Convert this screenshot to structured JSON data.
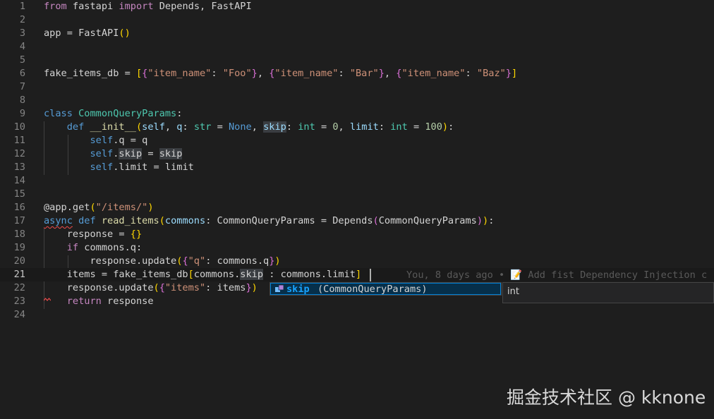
{
  "editor": {
    "lines": [
      {
        "n": "1",
        "segs": [
          [
            "from",
            "tok-ctrl"
          ],
          [
            " fastapi ",
            ""
          ],
          [
            "import",
            "tok-ctrl"
          ],
          [
            " Depends, FastAPI",
            ""
          ]
        ]
      },
      {
        "n": "2",
        "segs": []
      },
      {
        "n": "3",
        "segs": [
          [
            "app = FastAPI",
            ""
          ],
          [
            "()",
            "tok-br1"
          ]
        ]
      },
      {
        "n": "4",
        "segs": []
      },
      {
        "n": "5",
        "segs": []
      },
      {
        "n": "6",
        "segs": [
          [
            "fake_items_db = ",
            ""
          ],
          [
            "[",
            "tok-br1"
          ],
          [
            "{",
            "tok-br2"
          ],
          [
            "\"item_name\"",
            "tok-str"
          ],
          [
            ": ",
            ""
          ],
          [
            "\"Foo\"",
            "tok-str"
          ],
          [
            "}",
            "tok-br2"
          ],
          [
            ", ",
            ""
          ],
          [
            "{",
            "tok-br2"
          ],
          [
            "\"item_name\"",
            "tok-str"
          ],
          [
            ": ",
            ""
          ],
          [
            "\"Bar\"",
            "tok-str"
          ],
          [
            "}",
            "tok-br2"
          ],
          [
            ", ",
            ""
          ],
          [
            "{",
            "tok-br2"
          ],
          [
            "\"item_name\"",
            "tok-str"
          ],
          [
            ": ",
            ""
          ],
          [
            "\"Baz\"",
            "tok-str"
          ],
          [
            "}",
            "tok-br2"
          ],
          [
            "]",
            "tok-br1"
          ]
        ]
      },
      {
        "n": "7",
        "segs": []
      },
      {
        "n": "8",
        "segs": []
      },
      {
        "n": "9",
        "segs": [
          [
            "class",
            "tok-kw"
          ],
          [
            " ",
            ""
          ],
          [
            "CommonQueryParams",
            "tok-cls"
          ],
          [
            ":",
            ""
          ]
        ]
      },
      {
        "n": "10",
        "segs": [
          [
            "    ",
            ""
          ],
          [
            "def",
            "tok-kw"
          ],
          [
            " ",
            ""
          ],
          [
            "__init__",
            "tok-fn"
          ],
          [
            "(",
            "tok-br1"
          ],
          [
            "self",
            "tok-id"
          ],
          [
            ", ",
            ""
          ],
          [
            "q",
            "tok-id"
          ],
          [
            ": ",
            ""
          ],
          [
            "str",
            "tok-cls"
          ],
          [
            " = ",
            ""
          ],
          [
            "None",
            "tok-kw"
          ],
          [
            ", ",
            ""
          ],
          [
            "skip",
            "tok-id tok-hl"
          ],
          [
            ": ",
            ""
          ],
          [
            "int",
            "tok-cls"
          ],
          [
            " = ",
            ""
          ],
          [
            "0",
            "tok-num"
          ],
          [
            ", ",
            ""
          ],
          [
            "limit",
            "tok-id"
          ],
          [
            ": ",
            ""
          ],
          [
            "int",
            "tok-cls"
          ],
          [
            " = ",
            ""
          ],
          [
            "100",
            "tok-num"
          ],
          [
            ")",
            "tok-br1"
          ],
          [
            ":",
            ""
          ]
        ]
      },
      {
        "n": "11",
        "segs": [
          [
            "        ",
            ""
          ],
          [
            "self",
            "tok-kw"
          ],
          [
            ".q = q",
            ""
          ]
        ]
      },
      {
        "n": "12",
        "segs": [
          [
            "        ",
            ""
          ],
          [
            "self",
            "tok-kw"
          ],
          [
            ".",
            ""
          ],
          [
            "skip",
            "tok-hl"
          ],
          [
            " = ",
            ""
          ],
          [
            "skip",
            "tok-hl"
          ]
        ]
      },
      {
        "n": "13",
        "segs": [
          [
            "        ",
            ""
          ],
          [
            "self",
            "tok-kw"
          ],
          [
            ".limit = limit",
            ""
          ]
        ]
      },
      {
        "n": "14",
        "segs": []
      },
      {
        "n": "15",
        "segs": []
      },
      {
        "n": "16",
        "segs": [
          [
            "@app.get",
            ""
          ],
          [
            "(",
            "tok-br1"
          ],
          [
            "\"/items/\"",
            "tok-str"
          ],
          [
            ")",
            "tok-br1"
          ]
        ]
      },
      {
        "n": "17",
        "segs": [
          [
            "async",
            "tok-kw tok-err"
          ],
          [
            " ",
            ""
          ],
          [
            "def",
            "tok-kw"
          ],
          [
            " ",
            ""
          ],
          [
            "read_items",
            "tok-fn"
          ],
          [
            "(",
            "tok-br1"
          ],
          [
            "commons",
            "tok-id"
          ],
          [
            ": CommonQueryParams = Depends",
            ""
          ],
          [
            "(",
            "tok-br2"
          ],
          [
            "CommonQueryParams",
            ""
          ],
          [
            ")",
            "tok-br2"
          ],
          [
            ")",
            "tok-br1"
          ],
          [
            ":",
            ""
          ]
        ]
      },
      {
        "n": "18",
        "segs": [
          [
            "    response = ",
            ""
          ],
          [
            "{}",
            "tok-br1"
          ]
        ]
      },
      {
        "n": "19",
        "segs": [
          [
            "    ",
            ""
          ],
          [
            "if",
            "tok-ctrl"
          ],
          [
            " commons.q:",
            ""
          ]
        ]
      },
      {
        "n": "20",
        "segs": [
          [
            "        response.update",
            ""
          ],
          [
            "(",
            "tok-br1"
          ],
          [
            "{",
            "tok-br2"
          ],
          [
            "\"q\"",
            "tok-str"
          ],
          [
            ": commons.q",
            ""
          ],
          [
            "}",
            "tok-br2"
          ],
          [
            ")",
            "tok-br1"
          ]
        ]
      },
      {
        "n": "21",
        "segs": [
          [
            "    items = fake_items_db",
            ""
          ],
          [
            "[",
            "tok-br1"
          ],
          [
            "commons.",
            ""
          ],
          [
            "skip",
            "tok-hl"
          ],
          [
            " : commons.limit",
            ""
          ],
          [
            "]",
            "tok-br1"
          ]
        ]
      },
      {
        "n": "22",
        "segs": [
          [
            "    response.update",
            ""
          ],
          [
            "(",
            "tok-br1"
          ],
          [
            "{",
            "tok-br2"
          ],
          [
            "\"items\"",
            "tok-str"
          ],
          [
            ": items",
            ""
          ],
          [
            "}",
            "tok-br2"
          ],
          [
            ")",
            "tok-br1"
          ]
        ]
      },
      {
        "n": "23",
        "segs": [
          [
            "    ",
            ""
          ],
          [
            "return",
            "tok-ctrl"
          ],
          [
            " response",
            ""
          ]
        ]
      },
      {
        "n": "24",
        "segs": []
      }
    ],
    "blame": "You, 8 days ago • 📝 Add fist Dependency Injection c"
  },
  "suggest": {
    "label": "skip",
    "detail": "(CommonQueryParams)",
    "icon": "field-icon",
    "type_info": "int"
  },
  "watermark": "掘金技术社区 @ kknone",
  "colors": {
    "background": "#1e1e1e",
    "keyword": "#569cd6",
    "control": "#c586c0",
    "string": "#ce9178",
    "class": "#4ec9b0",
    "function": "#dcdcaa",
    "suggest_highlight": "#18a3ff"
  }
}
